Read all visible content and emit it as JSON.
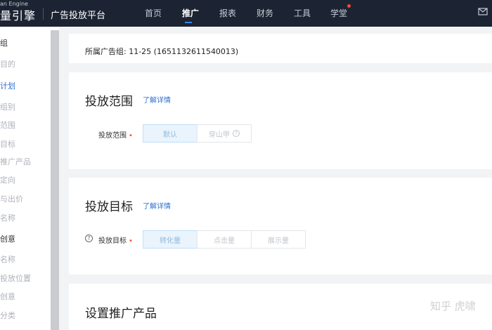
{
  "header": {
    "logo_small": "an Engine",
    "logo_text": "量引擎",
    "platform": "广告投放平台",
    "nav": [
      "首页",
      "推广",
      "报表",
      "财务",
      "工具",
      "学堂"
    ],
    "active_nav": "推广"
  },
  "sidebar": {
    "items": [
      "组",
      "目的",
      "计划",
      "组别",
      "范围",
      "目标",
      "推广产品",
      "定向",
      "与出价",
      "名称",
      "创意",
      "名称",
      "投放位置",
      "创意",
      "分类"
    ]
  },
  "adgroup_line": "所属广告组: 11-25 (1651132611540013)",
  "scope_section": {
    "title": "投放范围",
    "learn_more": "了解详情",
    "field_label": "投放范围",
    "options": [
      "默认",
      "穿山甲"
    ]
  },
  "goal_section": {
    "title": "投放目标",
    "learn_more": "了解详情",
    "field_label": "投放目标",
    "options": [
      "转化量",
      "点击量",
      "展示量"
    ]
  },
  "product_section": {
    "title": "设置推广产品"
  },
  "watermark": "知乎 虎啸"
}
